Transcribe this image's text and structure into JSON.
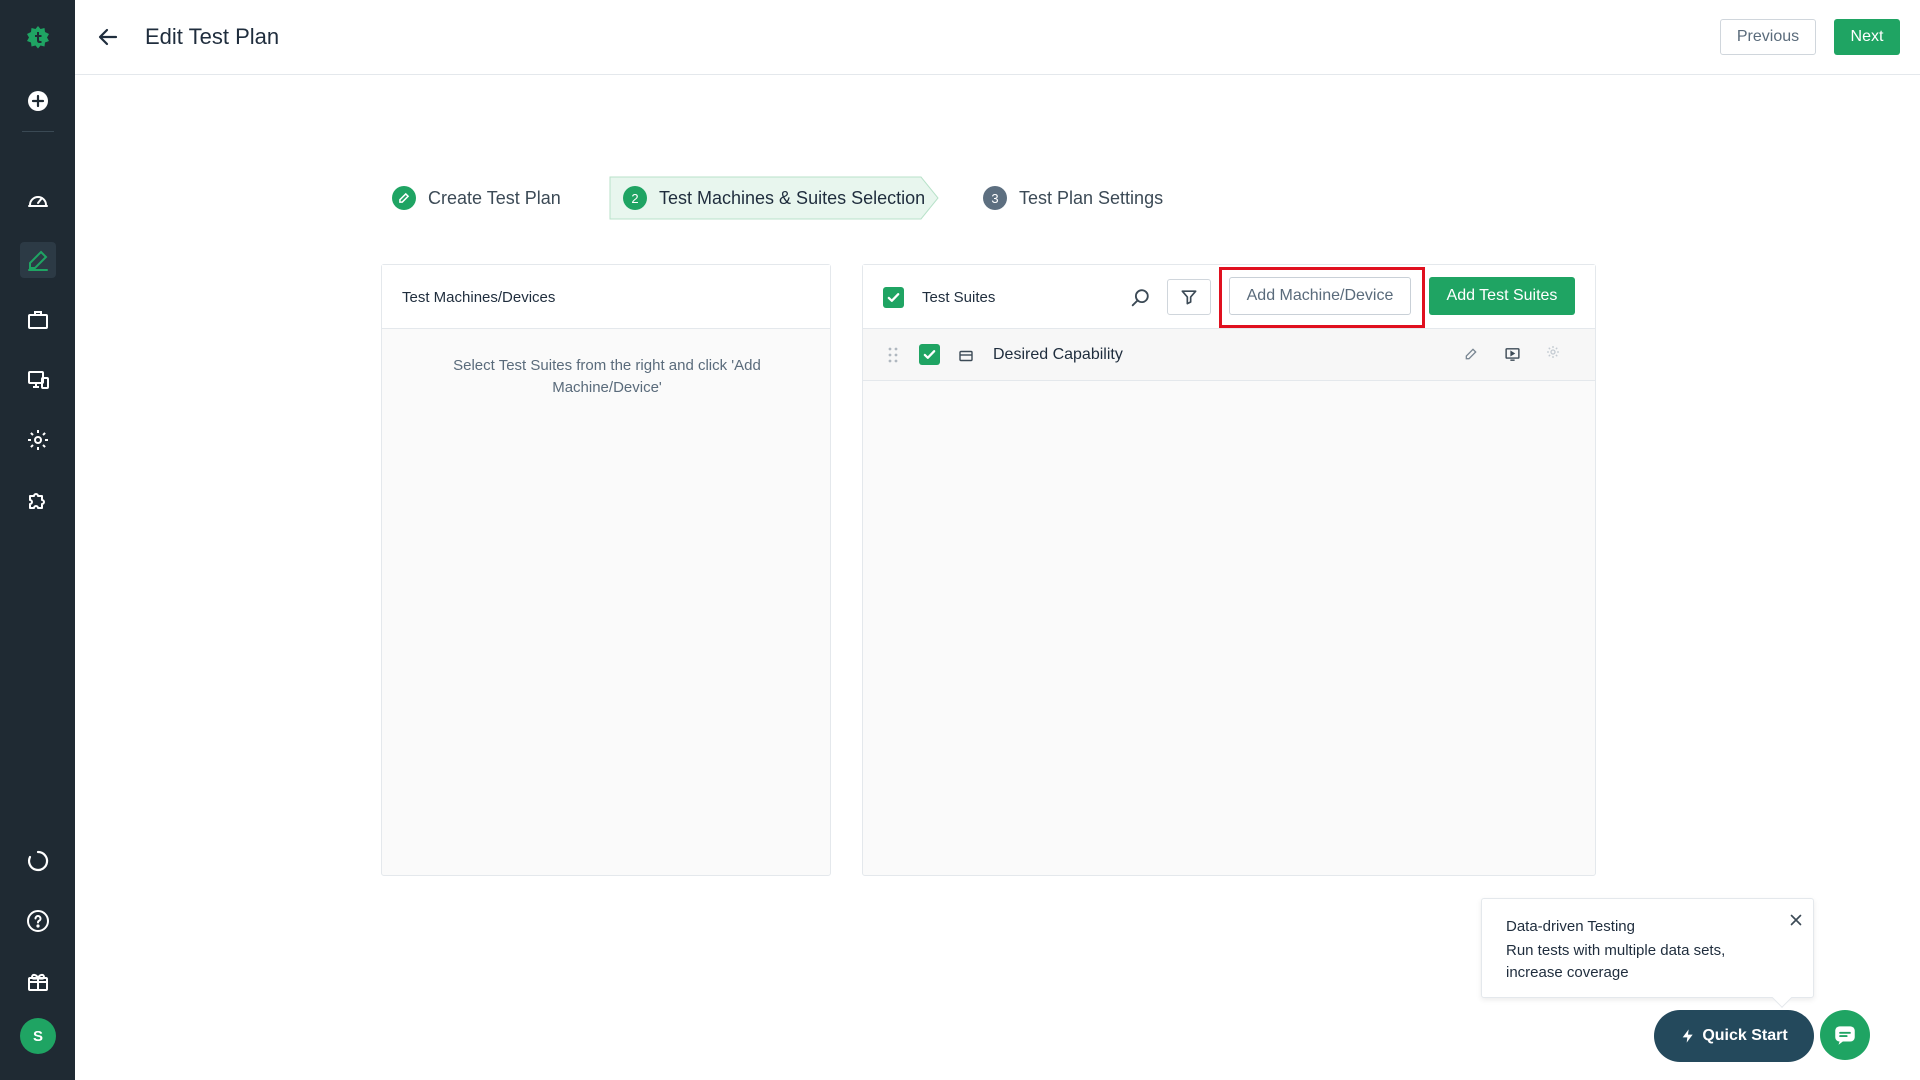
{
  "header": {
    "title": "Edit Test Plan",
    "previous_label": "Previous",
    "next_label": "Next"
  },
  "sidebar": {
    "avatar_initial": "S",
    "items": [
      {
        "icon": "dashboard-icon"
      },
      {
        "icon": "edit-icon",
        "active": true
      },
      {
        "icon": "briefcase-icon"
      },
      {
        "icon": "monitor-icon"
      },
      {
        "icon": "gear-icon"
      },
      {
        "icon": "puzzle-icon"
      },
      {
        "icon": "refresh-icon"
      },
      {
        "icon": "help-icon"
      },
      {
        "icon": "gift-icon"
      }
    ]
  },
  "stepper": {
    "steps": [
      {
        "number": "",
        "label": "Create Test Plan",
        "state": "done"
      },
      {
        "number": "2",
        "label": "Test Machines & Suites Selection",
        "state": "current"
      },
      {
        "number": "3",
        "label": "Test Plan Settings",
        "state": "pending"
      }
    ]
  },
  "left_panel": {
    "title": "Test Machines/Devices",
    "empty_message": "Select Test Suites from the right and click 'Add Machine/Device'"
  },
  "right_panel": {
    "title": "Test Suites",
    "add_machine_label": "Add Machine/Device",
    "add_suites_label": "Add Test Suites",
    "suites": [
      {
        "name": "Desired Capability",
        "checked": true
      }
    ]
  },
  "popover": {
    "title": "Data-driven Testing",
    "body": "Run tests with multiple data sets, increase coverage"
  },
  "quick_start_label": "Quick Start",
  "colors": {
    "sidebar_bg": "#1f2a33",
    "accent_green": "#1fa463",
    "highlight_red": "#e0101f",
    "quick_start_bg": "#24495c"
  }
}
